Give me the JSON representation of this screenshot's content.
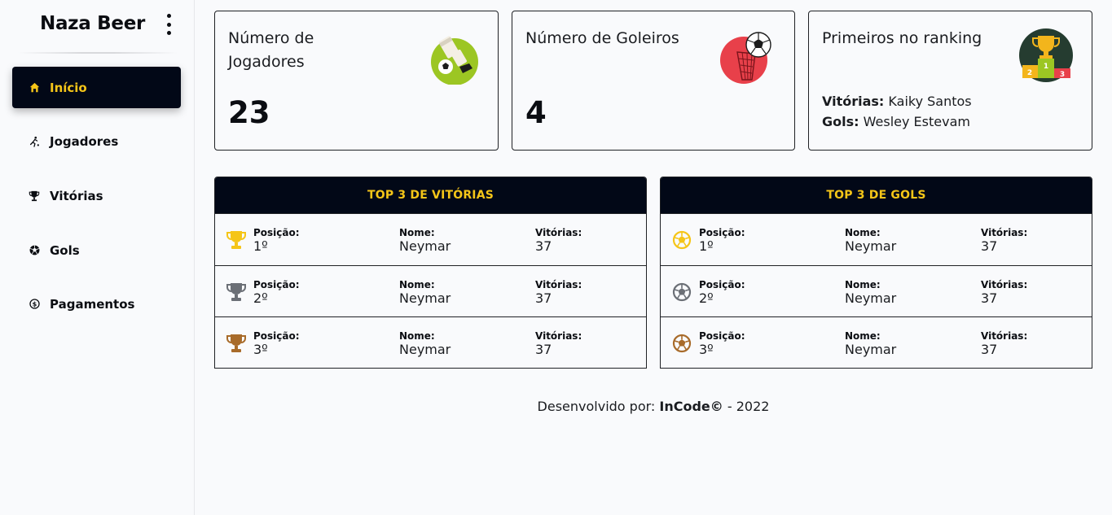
{
  "sidebar": {
    "brand": "Naza Beer",
    "items": [
      {
        "label": "Início",
        "icon": "home-icon"
      },
      {
        "label": "Jogadores",
        "icon": "player-kick-icon"
      },
      {
        "label": "Vitórias",
        "icon": "trophy-icon"
      },
      {
        "label": "Gols",
        "icon": "soccer-ball-icon"
      },
      {
        "label": "Pagamentos",
        "icon": "dollar-circle-icon"
      }
    ]
  },
  "cards": {
    "players": {
      "title": "Número de Jogadores",
      "value": "23"
    },
    "goalkeepers": {
      "title": "Número de Goleiros",
      "value": "4"
    },
    "ranking": {
      "title": "Primeiros no ranking",
      "wins_label": "Vitórias:",
      "wins_value": "Kaiky Santos",
      "goals_label": "Gols:",
      "goals_value": "Wesley Estevam"
    }
  },
  "top_wins": {
    "title": "TOP 3 DE VITÓRIAS",
    "rows": [
      {
        "pos_label": "Posição:",
        "pos": "1º",
        "name_label": "Nome:",
        "name": "Neymar",
        "stat_label": "Vitórias:",
        "stat": "37",
        "medal": "gold"
      },
      {
        "pos_label": "Posição:",
        "pos": "2º",
        "name_label": "Nome:",
        "name": "Neymar",
        "stat_label": "Vitórias:",
        "stat": "37",
        "medal": "silver"
      },
      {
        "pos_label": "Posição:",
        "pos": "3º",
        "name_label": "Nome:",
        "name": "Neymar",
        "stat_label": "Vitórias:",
        "stat": "37",
        "medal": "bronze"
      }
    ]
  },
  "top_goals": {
    "title": "TOP 3 DE GOLS",
    "rows": [
      {
        "pos_label": "Posição:",
        "pos": "1º",
        "name_label": "Nome:",
        "name": "Neymar",
        "stat_label": "Vitórias:",
        "stat": "37",
        "medal": "gold"
      },
      {
        "pos_label": "Posição:",
        "pos": "2º",
        "name_label": "Nome:",
        "name": "Neymar",
        "stat_label": "Vitórias:",
        "stat": "37",
        "medal": "silver"
      },
      {
        "pos_label": "Posição:",
        "pos": "3º",
        "name_label": "Nome:",
        "name": "Neymar",
        "stat_label": "Vitórias:",
        "stat": "37",
        "medal": "bronze"
      }
    ]
  },
  "footer": {
    "prefix": "Desenvolvido por:",
    "company": "InCode©",
    "suffix": "- 2022"
  },
  "colors": {
    "accent": "#f5c518",
    "dark": "#020817",
    "gold": "#f5c518",
    "silver": "#6b6f76",
    "bronze": "#a86b2a"
  }
}
